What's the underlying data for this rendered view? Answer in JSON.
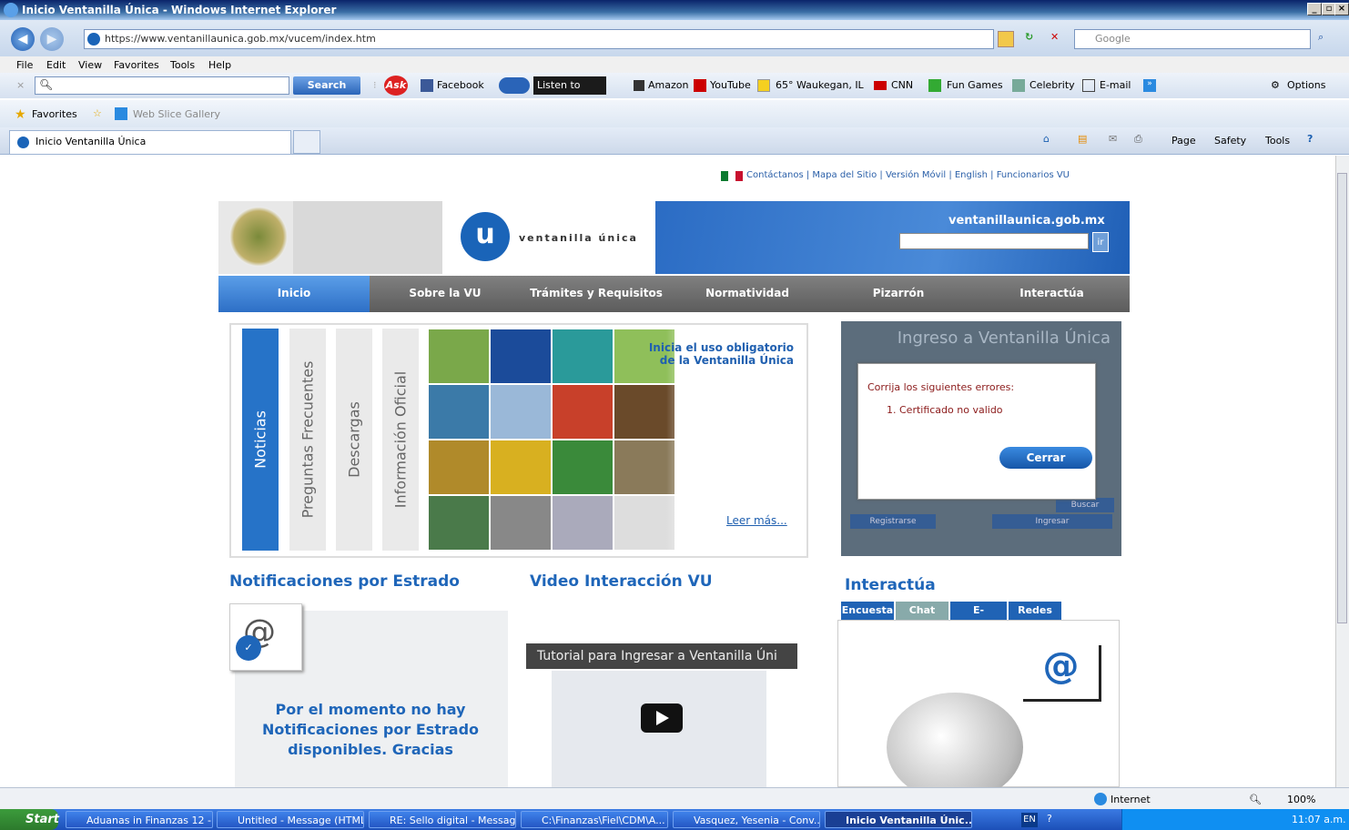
{
  "window": {
    "title": "Inicio Ventanilla Única - Windows Internet Explorer",
    "controls": [
      "_",
      "×"
    ]
  },
  "address": {
    "url_host": "https://www.ventanillaunica.gob.mx/vucem/index.htm",
    "search_placeholder": "Google"
  },
  "menu": [
    "File",
    "Edit",
    "View",
    "Favorites",
    "Tools",
    "Help"
  ],
  "toolbar": {
    "search_label": "Search",
    "facebook": "Facebook",
    "listen": "Listen to music",
    "amazon": "Amazon",
    "youtube": "YouTube",
    "weather": "65° Waukegan, IL",
    "cnn": "CNN",
    "fungames": "Fun Games",
    "celebrity": "Celebrity",
    "email": "E-mail",
    "options": "Options"
  },
  "favorites": {
    "label": "Favorites",
    "webslice": "Web Slice Gallery"
  },
  "tab": {
    "title": "Inicio Ventanilla Única"
  },
  "cmdbar": {
    "page": "Page",
    "safety": "Safety",
    "tools": "Tools"
  },
  "page": {
    "toplinks": "Contáctanos | Mapa del Sitio | Versión Móvil | English | Funcionarios VU",
    "logo_letter": "u",
    "logo_text": "ventanilla única",
    "domain": "ventanillaunica.gob.mx",
    "ir": "ir",
    "nav": [
      "Inicio",
      "Sobre la VU",
      "Trámites y Requisitos",
      "Normatividad",
      "Pizarrón",
      "Interactúa"
    ],
    "vtabs": [
      "Noticias",
      "Preguntas Frecuentes",
      "Descargas",
      "Información Oficial"
    ],
    "news_title": "Inicia el uso obligatorio de la Ventanilla Única",
    "leer_mas": "Leer más...",
    "login_title": "Ingreso a Ventanilla Única",
    "dialog": {
      "message": "Corrija los siguientes errores:",
      "item": "1.  Certificado no valido",
      "close": "Cerrar"
    },
    "login_buttons": [
      "Buscar",
      "Registrarse",
      "Ingresar"
    ],
    "notif_title": "Notificaciones por Estrado",
    "notif_text": "Por el momento no hay Notificaciones por Estrado disponibles. Gracias",
    "video_title": "Video Interacción VU",
    "video_head": "Tutorial para Ingresar a Ventanilla Úni",
    "interactua_title": "Interactúa",
    "interactua_tabs": [
      "Encuesta",
      "Chat",
      "E-learning",
      "Redes"
    ]
  },
  "status": {
    "zone": "Internet",
    "zoom": "100%"
  },
  "taskbar": {
    "start": "Start",
    "tasks": [
      "Aduanas in Finanzas 12 -...",
      "Untitled - Message (HTML)",
      "RE: Sello digital - Messag...",
      "C:\\Finanzas\\Fiel\\CDM\\A...",
      "Vasquez, Yesenia - Conv...",
      "Inicio Ventanilla Únic..."
    ],
    "lang": "EN",
    "time": "11:07 a.m."
  }
}
